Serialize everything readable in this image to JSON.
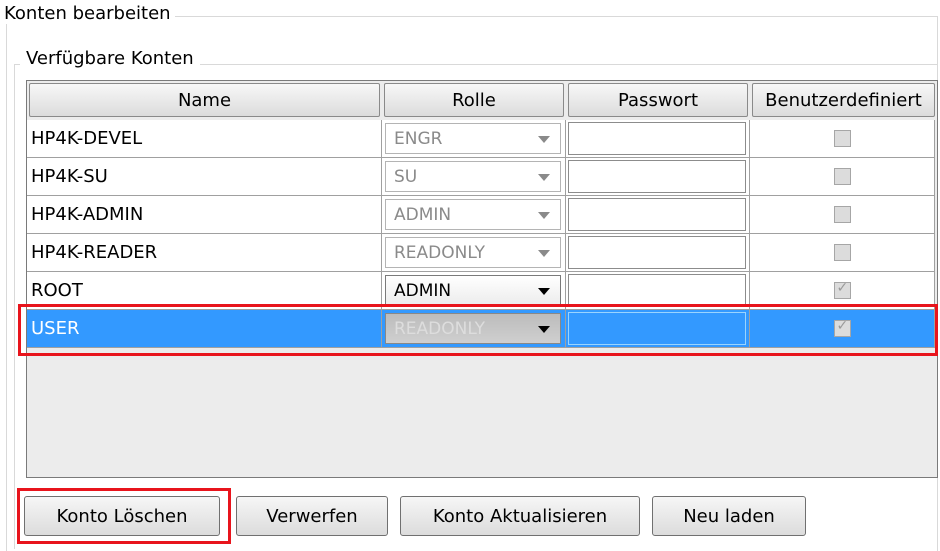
{
  "outer_group": {
    "title": "Konten bearbeiten"
  },
  "inner_group": {
    "title": "Verfügbare Konten"
  },
  "table": {
    "headers": {
      "name": "Name",
      "role": "Rolle",
      "password": "Passwort",
      "custom": "Benutzerdefiniert"
    },
    "rows": [
      {
        "name": "HP4K-DEVEL",
        "role": "ENGR",
        "password": "",
        "custom_checked": false,
        "role_enabled": false,
        "selected": false
      },
      {
        "name": "HP4K-SU",
        "role": "SU",
        "password": "",
        "custom_checked": false,
        "role_enabled": false,
        "selected": false
      },
      {
        "name": "HP4K-ADMIN",
        "role": "ADMIN",
        "password": "",
        "custom_checked": false,
        "role_enabled": false,
        "selected": false
      },
      {
        "name": "HP4K-READER",
        "role": "READONLY",
        "password": "",
        "custom_checked": false,
        "role_enabled": false,
        "selected": false
      },
      {
        "name": "ROOT",
        "role": "ADMIN",
        "password": "",
        "custom_checked": true,
        "role_enabled": true,
        "selected": false
      },
      {
        "name": "USER",
        "role": "READONLY",
        "password": "",
        "custom_checked": true,
        "role_enabled": true,
        "selected": true
      }
    ]
  },
  "buttons": {
    "delete": "Konto Löschen",
    "discard": "Verwerfen",
    "update": "Konto Aktualisieren",
    "reload": "Neu laden"
  },
  "colors": {
    "selection": "#3399ff",
    "highlight": "#e8141c"
  }
}
